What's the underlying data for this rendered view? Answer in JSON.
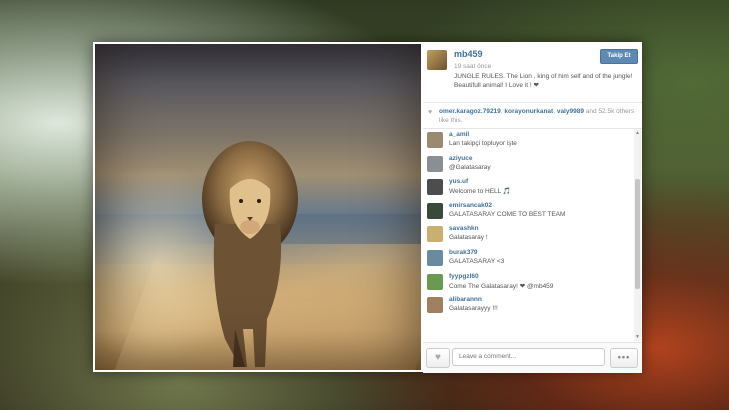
{
  "post": {
    "username": "mb459",
    "time_ago": "19 saat önce",
    "caption": "JUNGLE RULES. The Lion , king of him self and of the jungle! Beautifull animal! I Love it ! ❤",
    "follow_label": "Takip Et",
    "likes": {
      "users": [
        "omer.karagoz.79219",
        "korayonurkanat",
        "valy9989"
      ],
      "and": "and",
      "others": "52.5k others like this."
    }
  },
  "comments": [
    {
      "user": "a_amil",
      "text": "Lan takipçi topluyor işte",
      "color": "#9a8a70"
    },
    {
      "user": "aziyuce",
      "text": "@Galatasaray",
      "mention": true,
      "color": "#8a8f94"
    },
    {
      "user": "yus.uf",
      "text": "Welcome to HELL 🎵",
      "color": "#4d4d4d"
    },
    {
      "user": "emirsancak02",
      "text": "GALATASARAY COME TO BEST TEAM",
      "color": "#3a4a3a"
    },
    {
      "user": "savashkn",
      "text": "Galatasaray !",
      "color": "#c9b070"
    },
    {
      "user": "burak379",
      "text": "GALATASARAY <3",
      "color": "#6a8aa0"
    },
    {
      "user": "fyypgzl60",
      "text": "Come The Galatasaray! ❤ @mb459",
      "color": "#6a9a50"
    },
    {
      "user": "alibarannn",
      "text": "Galatasarayyy !!!",
      "color": "#a08060"
    }
  ],
  "footer": {
    "comment_placeholder": "Leave a comment...",
    "more_label": "•••",
    "like_icon": "♥"
  },
  "scrollbar": {
    "up": "▲",
    "down": "▼"
  }
}
